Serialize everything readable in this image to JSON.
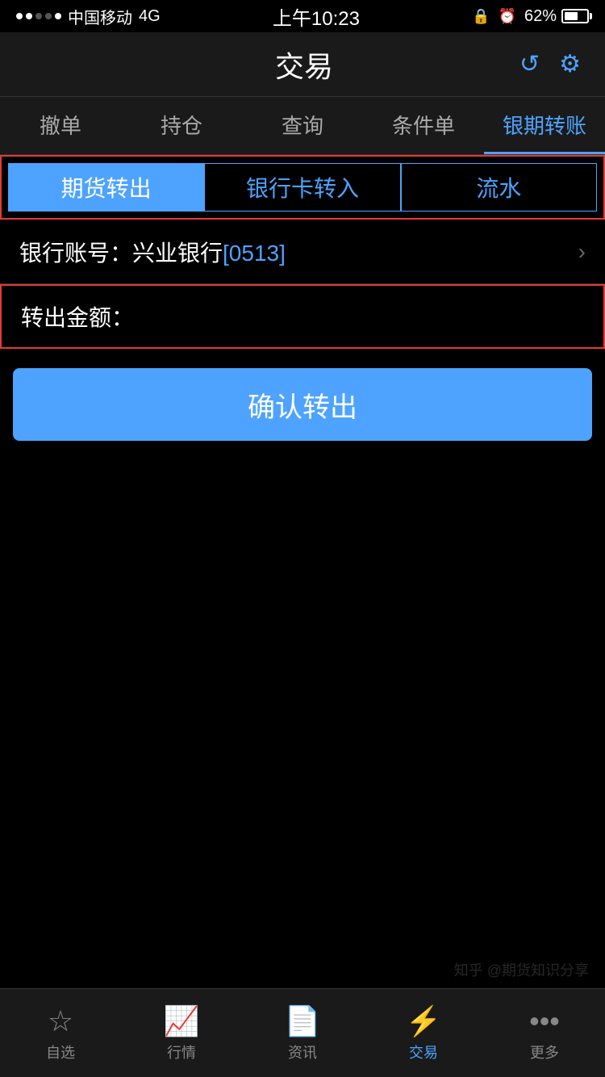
{
  "statusBar": {
    "carrier": "中国移动",
    "network": "4G",
    "time": "上午10:23",
    "batteryPercent": "62%"
  },
  "header": {
    "title": "交易",
    "refreshIcon": "↺",
    "settingsIcon": "⚙"
  },
  "navTabs": [
    {
      "label": "撤单",
      "active": false
    },
    {
      "label": "持仓",
      "active": false
    },
    {
      "label": "查询",
      "active": false
    },
    {
      "label": "条件单",
      "active": false
    },
    {
      "label": "银期转账",
      "active": true
    }
  ],
  "subTabs": [
    {
      "label": "期货转出",
      "active": true
    },
    {
      "label": "银行卡转入",
      "active": false
    },
    {
      "label": "流水",
      "active": false
    }
  ],
  "bankRow": {
    "prefix": "银行账号：兴业银行",
    "highlight": "[0513]"
  },
  "amountRow": {
    "label": "转出金额："
  },
  "confirmButton": {
    "label": "确认转出"
  },
  "bottomNav": [
    {
      "icon": "☆",
      "label": "自选",
      "active": false
    },
    {
      "icon": "📈",
      "label": "行情",
      "active": false
    },
    {
      "icon": "📄",
      "label": "资讯",
      "active": false
    },
    {
      "icon": "⚡",
      "label": "交易",
      "active": true
    },
    {
      "icon": "•••",
      "label": "更多",
      "active": false
    }
  ],
  "watermark": "知乎 @期货知识分享"
}
